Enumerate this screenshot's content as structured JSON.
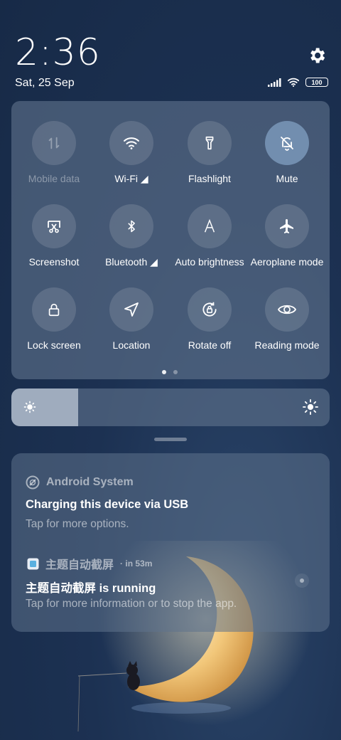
{
  "status": {
    "time": "2:36",
    "date": "Sat, 25 Sep",
    "battery": "100"
  },
  "quick_settings": {
    "tiles": [
      {
        "label": "Mobile data",
        "icon": "mobile-data-icon",
        "state": "disabled"
      },
      {
        "label": "Wi-Fi ◢",
        "icon": "wifi-icon",
        "state": "off"
      },
      {
        "label": "Flashlight",
        "icon": "flashlight-icon",
        "state": "off"
      },
      {
        "label": "Mute",
        "icon": "bell-off-icon",
        "state": "on"
      },
      {
        "label": "Screenshot",
        "icon": "screenshot-icon",
        "state": "off"
      },
      {
        "label": "Bluetooth ◢",
        "icon": "bluetooth-icon",
        "state": "off"
      },
      {
        "label": "Auto brightness",
        "icon": "auto-brightness-icon",
        "state": "off"
      },
      {
        "label": "Aeroplane mode",
        "icon": "airplane-icon",
        "state": "off"
      },
      {
        "label": "Lock screen",
        "icon": "lock-icon",
        "state": "off"
      },
      {
        "label": "Location",
        "icon": "location-icon",
        "state": "off"
      },
      {
        "label": "Rotate off",
        "icon": "rotate-lock-icon",
        "state": "off"
      },
      {
        "label": "Reading mode",
        "icon": "eye-icon",
        "state": "off"
      }
    ],
    "page_count": 2,
    "current_page": 1
  },
  "brightness": {
    "level_fraction": 0.21
  },
  "notifications": [
    {
      "app": "Android System",
      "time": "",
      "title": "Charging this device via USB",
      "body": "Tap for more options."
    },
    {
      "app": "主题自动截屏",
      "time": "in 53m",
      "title": "主题自动截屏 is running",
      "body": "Tap for more information or to stop the app."
    }
  ],
  "colors": {
    "background": "#1c3152",
    "panel": "#5f738c",
    "active_tile": "#82a0c3"
  }
}
